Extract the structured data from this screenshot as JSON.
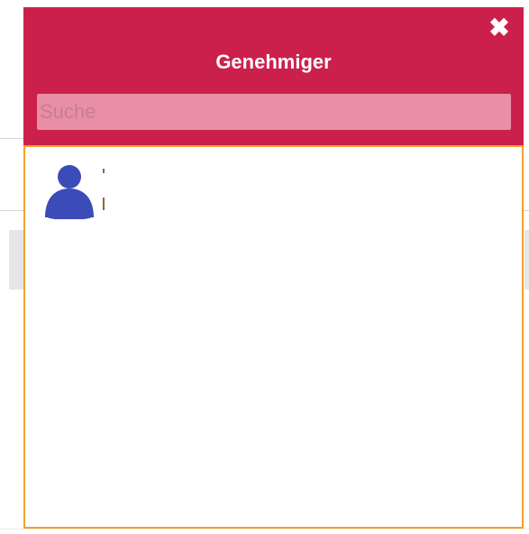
{
  "dialog": {
    "title": "Genehmiger",
    "close_icon": "close-icon",
    "close_glyph": "✖"
  },
  "search": {
    "placeholder": "Suche",
    "value": ""
  },
  "results": {
    "items": [
      {
        "icon": "person-avatar-icon",
        "avatar_color": "#3b4bb8",
        "name": "",
        "detail": ""
      }
    ]
  },
  "colors": {
    "header": "#cc204c",
    "search_background": "#e88fa5",
    "panel_border": "#f0a22c"
  }
}
